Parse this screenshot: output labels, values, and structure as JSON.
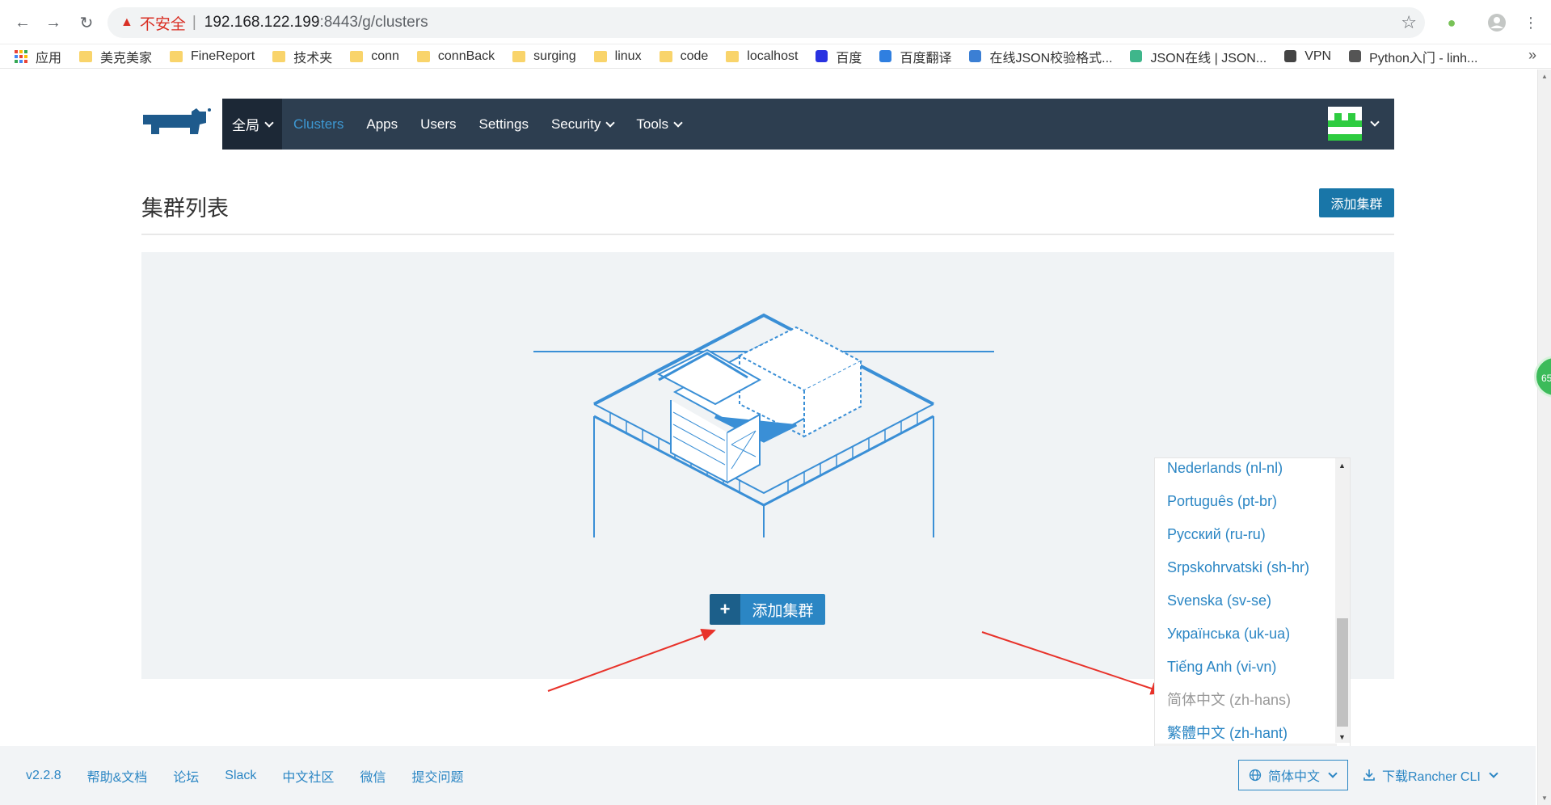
{
  "browser": {
    "insecure_label": "不安全",
    "url_host": "192.168.122.199",
    "url_rest": ":8443/g/clusters",
    "bookmarks": [
      {
        "label": "应用",
        "icon": "apps-grid-icon"
      },
      {
        "label": "美克美家",
        "icon": "folder-icon"
      },
      {
        "label": "FineReport",
        "icon": "folder-icon"
      },
      {
        "label": "技术夹",
        "icon": "folder-icon"
      },
      {
        "label": "conn",
        "icon": "folder-icon"
      },
      {
        "label": "connBack",
        "icon": "folder-icon"
      },
      {
        "label": "surging",
        "icon": "folder-icon"
      },
      {
        "label": "linux",
        "icon": "folder-icon"
      },
      {
        "label": "code",
        "icon": "folder-icon"
      },
      {
        "label": "localhost",
        "icon": "folder-icon"
      },
      {
        "label": "百度",
        "icon": "baidu-paw-icon"
      },
      {
        "label": "百度翻译",
        "icon": "translate-icon"
      },
      {
        "label": "在线JSON校验格式...",
        "icon": "json-icon"
      },
      {
        "label": "JSON在线 | JSON...",
        "icon": "gear-green-icon"
      },
      {
        "label": "VPN",
        "icon": "globe-icon"
      },
      {
        "label": "Python入门 - linh...",
        "icon": "python-icon"
      }
    ],
    "more": "»"
  },
  "nav": {
    "global_label": "全局",
    "items": [
      {
        "label": "Clusters",
        "active": true,
        "dropdown": false
      },
      {
        "label": "Apps",
        "active": false,
        "dropdown": false
      },
      {
        "label": "Users",
        "active": false,
        "dropdown": false
      },
      {
        "label": "Settings",
        "active": false,
        "dropdown": false
      },
      {
        "label": "Security",
        "active": false,
        "dropdown": true
      },
      {
        "label": "Tools",
        "active": false,
        "dropdown": true
      }
    ]
  },
  "page": {
    "title": "集群列表",
    "add_button_top": "添加集群",
    "add_button_main": "添加集群"
  },
  "language_dropdown": {
    "items": [
      {
        "label": "Nederlands (nl-nl)",
        "current": false
      },
      {
        "label": "Português (pt-br)",
        "current": false
      },
      {
        "label": "Русский (ru-ru)",
        "current": false
      },
      {
        "label": "Srpskohrvatski (sh-hr)",
        "current": false
      },
      {
        "label": "Svenska (sv-se)",
        "current": false
      },
      {
        "label": "Українська (uk-ua)",
        "current": false
      },
      {
        "label": "Tiếng Anh (vi-vn)",
        "current": false
      },
      {
        "label": "简体中文 (zh-hans)",
        "current": true
      },
      {
        "label": "繁體中文 (zh-hant)",
        "current": false
      }
    ]
  },
  "footer": {
    "links": [
      "v2.2.8",
      "帮助&文档",
      "论坛",
      "Slack",
      "中文社区",
      "微信",
      "提交问题"
    ],
    "language_selected": "简体中文",
    "cli_label": "下载Rancher CLI"
  },
  "side_badge": "65",
  "colors": {
    "nav_bg": "#2d3e50",
    "nav_active": "#3d98d3",
    "primary_button": "#1976a8",
    "link": "#2b86c4",
    "panel_bg": "#f0f3f5",
    "arrow": "#e8322a"
  }
}
